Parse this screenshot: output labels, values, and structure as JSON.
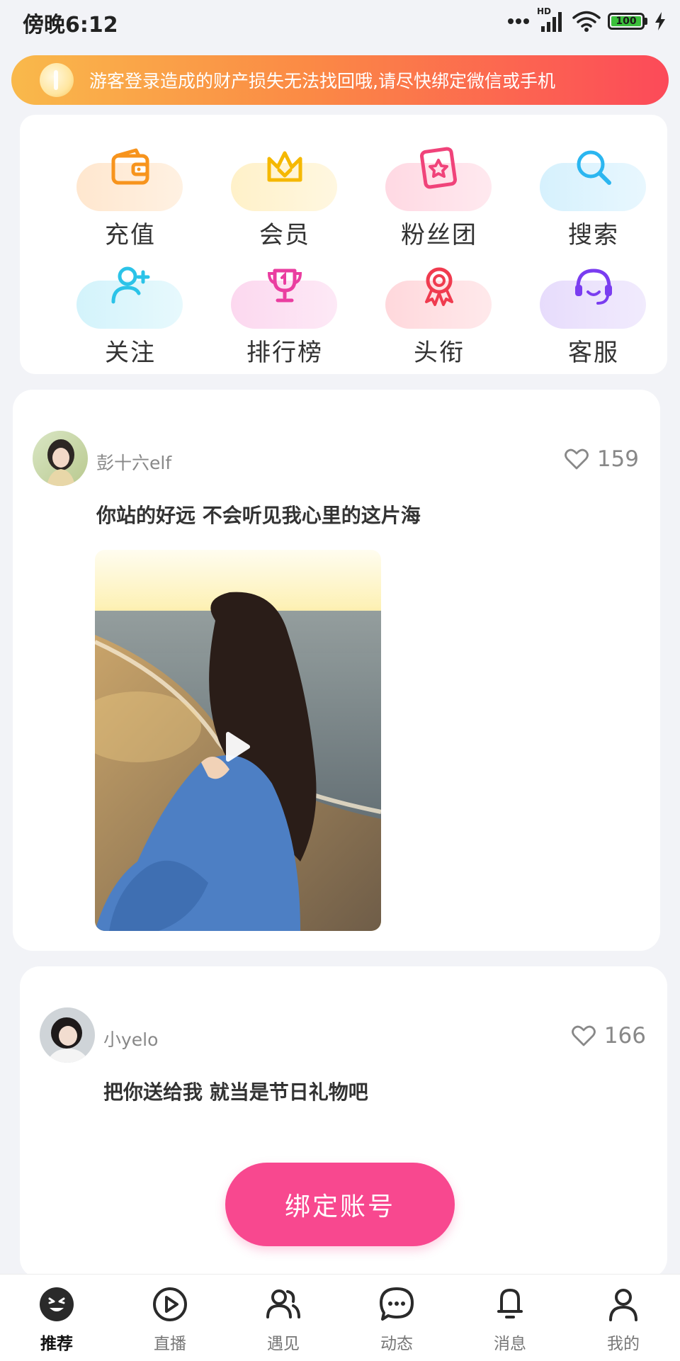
{
  "status_bar": {
    "time": "傍晚6:12",
    "network": "HD",
    "battery": "100"
  },
  "notice": {
    "text": "游客登录造成的财产损失无法找回哦,请尽快绑定微信或手机"
  },
  "quick_menu": {
    "items": [
      {
        "label": "充值",
        "icon": "wallet-icon",
        "color": "#f7941d"
      },
      {
        "label": "会员",
        "icon": "crown-icon",
        "color": "#f5b800"
      },
      {
        "label": "粉丝团",
        "icon": "fan-badge-icon",
        "color": "#f0437a"
      },
      {
        "label": "搜索",
        "icon": "search-icon",
        "color": "#2bb6f0"
      },
      {
        "label": "关注",
        "icon": "add-user-icon",
        "color": "#2bc3e8"
      },
      {
        "label": "排行榜",
        "icon": "trophy-icon",
        "color": "#ea3ea0"
      },
      {
        "label": "头衔",
        "icon": "medal-icon",
        "color": "#f03b4f"
      },
      {
        "label": "客服",
        "icon": "headset-icon",
        "color": "#7a3df0"
      }
    ]
  },
  "feed": {
    "posts": [
      {
        "username": "彭十六elf",
        "likes": "159",
        "caption": "你站的好远 不会听见我心里的这片海"
      },
      {
        "username": "小yelo",
        "likes": "166",
        "caption": "把你送给我 就当是节日礼物吧"
      }
    ]
  },
  "bind_button": {
    "label": "绑定账号"
  },
  "bottom_nav": {
    "items": [
      {
        "label": "推荐",
        "icon": "smile-face-icon",
        "active": true
      },
      {
        "label": "直播",
        "icon": "play-circle-icon",
        "active": false
      },
      {
        "label": "遇见",
        "icon": "people-icon",
        "active": false
      },
      {
        "label": "动态",
        "icon": "chat-bubble-icon",
        "active": false
      },
      {
        "label": "消息",
        "icon": "bell-icon",
        "active": false
      },
      {
        "label": "我的",
        "icon": "user-icon",
        "active": false
      }
    ]
  },
  "colors": {
    "accent_pink": "#f8488f",
    "notice_gradient_start": "#f9b94b",
    "notice_gradient_end": "#fc4a59",
    "page_background": "#f2f3f7"
  }
}
